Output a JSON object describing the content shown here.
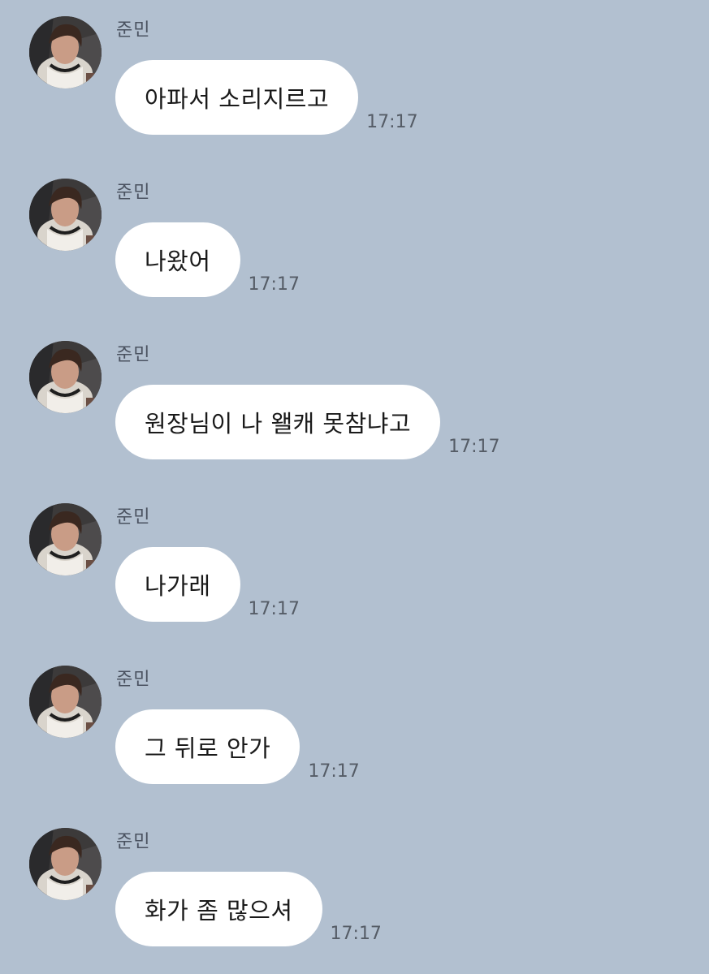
{
  "chat": {
    "messages": [
      {
        "sender": "준민",
        "text": "아파서 소리지르고",
        "time": "17:17",
        "avatar_icon": "profile-photo-icon"
      },
      {
        "sender": "준민",
        "text": "나왔어",
        "time": "17:17",
        "avatar_icon": "profile-photo-icon"
      },
      {
        "sender": "준민",
        "text": "원장님이 나 왤캐 못참냐고",
        "time": "17:17",
        "avatar_icon": "profile-photo-icon"
      },
      {
        "sender": "준민",
        "text": "나가래",
        "time": "17:17",
        "avatar_icon": "profile-photo-icon"
      },
      {
        "sender": "준민",
        "text": "그 뒤로 안가",
        "time": "17:17",
        "avatar_icon": "profile-photo-icon"
      },
      {
        "sender": "준민",
        "text": "화가 좀 많으셔",
        "time": "17:17",
        "avatar_icon": "profile-photo-icon"
      }
    ]
  },
  "colors": {
    "background": "#b2c0d0",
    "bubble": "#ffffff",
    "text": "#1a1a1a",
    "sender": "#4a5260",
    "time": "#555c66"
  }
}
